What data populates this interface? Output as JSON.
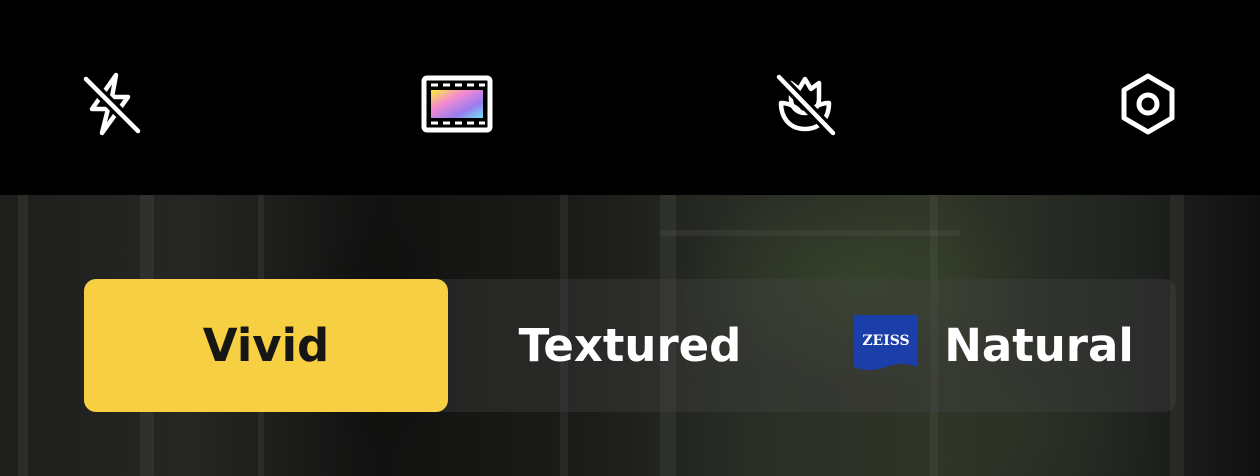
{
  "toolbar": {
    "icons": [
      {
        "name": "flash-off-icon"
      },
      {
        "name": "filter-icon"
      },
      {
        "name": "macro-off-icon"
      },
      {
        "name": "settings-icon"
      }
    ]
  },
  "modes": {
    "items": [
      {
        "label": "Vivid",
        "selected": true
      },
      {
        "label": "Textured",
        "selected": false
      },
      {
        "label": "Natural",
        "selected": false,
        "logo": "ZEISS"
      }
    ]
  },
  "colors": {
    "accent": "#f6cf43",
    "zeiss_blue": "#1c3ea8"
  }
}
